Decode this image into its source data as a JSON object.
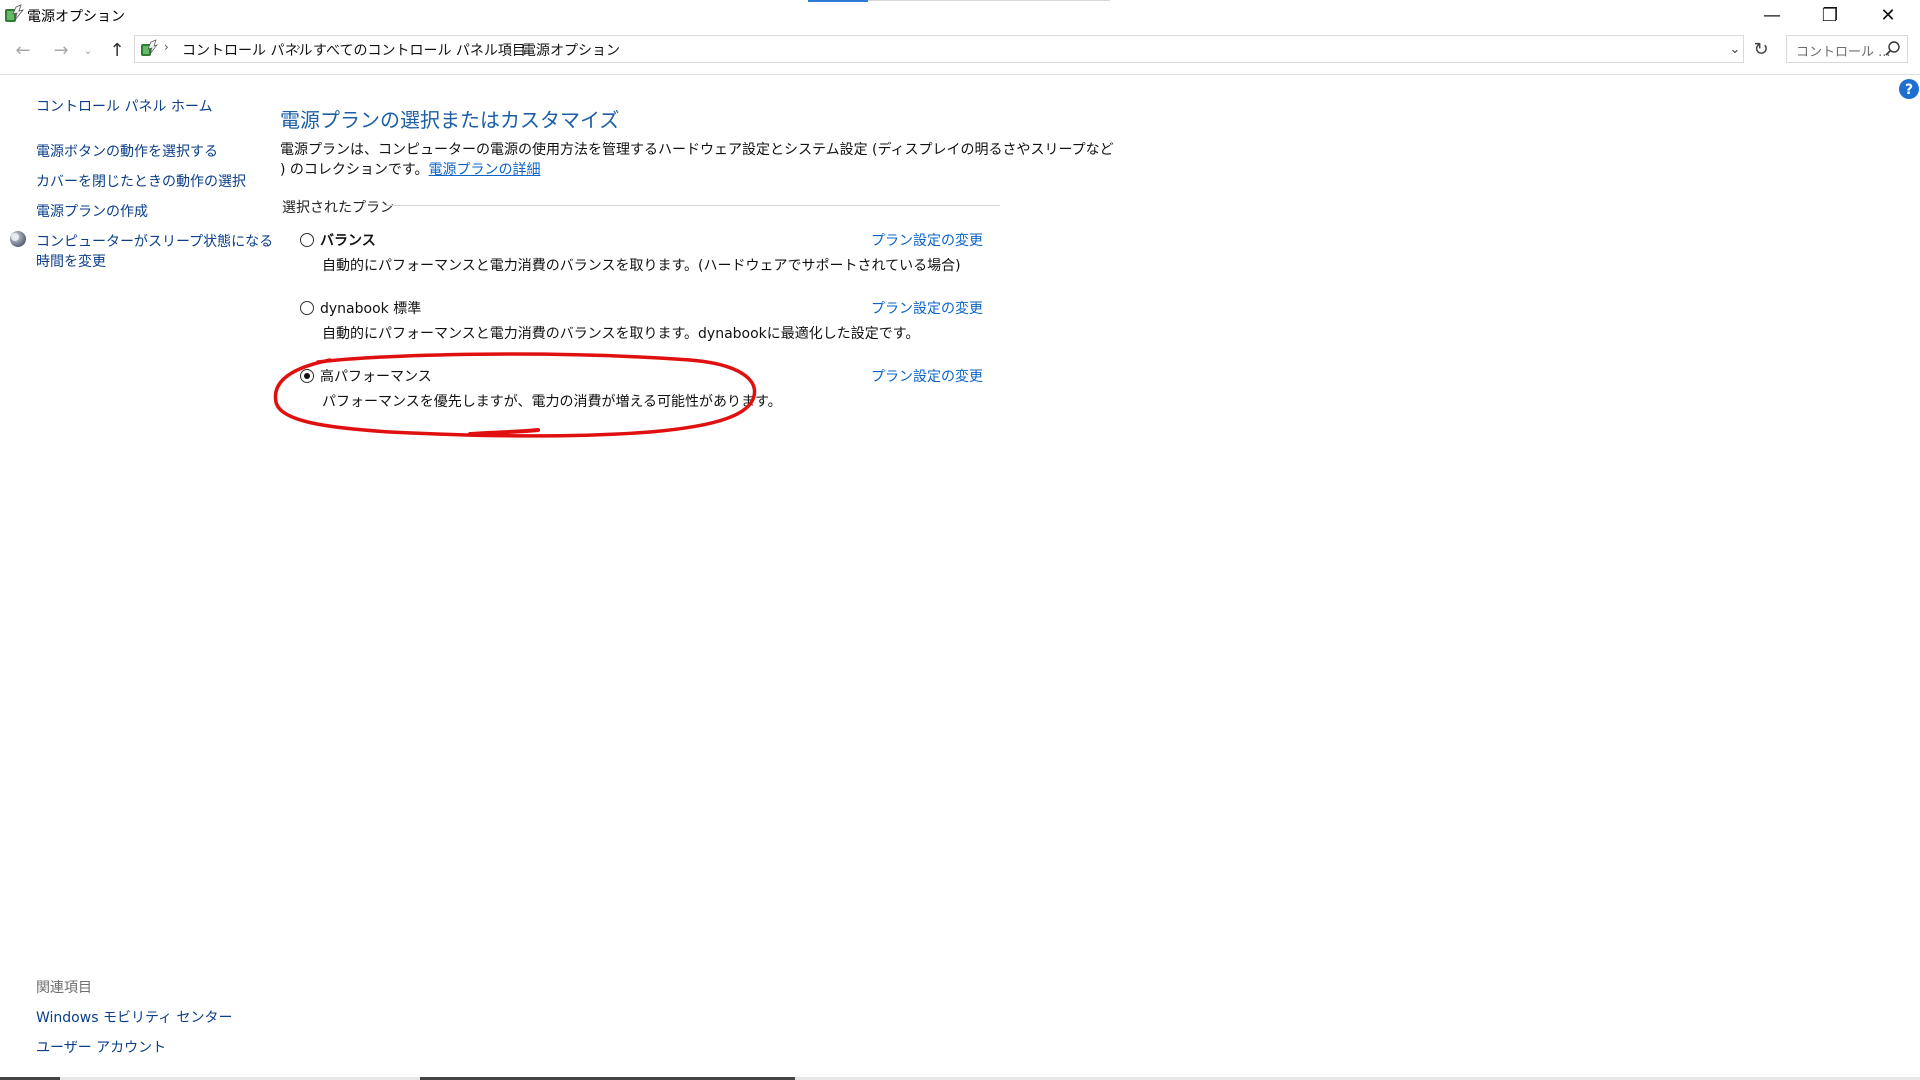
{
  "window": {
    "title": "電源オプション",
    "controls": {
      "minimize": "—",
      "maximize": "❐",
      "close": "✕"
    }
  },
  "nav": {
    "back": "←",
    "forward": "→",
    "recent": "⌄",
    "up": "↑",
    "breadcrumbs": [
      "コントロール パネル",
      "すべてのコントロール パネル項目",
      "電源オプション"
    ],
    "separator": "›",
    "dropdown": "⌄",
    "refresh": "↻",
    "search_placeholder": "コントロール ..."
  },
  "left_pane": {
    "home": "コントロール パネル ホーム",
    "tasks": [
      "電源ボタンの動作を選択する",
      "カバーを閉じたときの動作の選択",
      "電源プランの作成"
    ],
    "sleep_line1": "コンピューターがスリープ状態になる",
    "sleep_line2": "時間を変更",
    "related_label": "関連項目",
    "related": [
      "Windows モビリティ センター",
      "ユーザー アカウント"
    ]
  },
  "main": {
    "title": "電源プランの選択またはカスタマイズ",
    "desc_line1": "電源プランは、コンピューターの電源の使用方法を管理するハードウェア設定とシステム設定 (ディスプレイの明るさやスリープなど",
    "desc_line2": ") のコレクションです。",
    "desc_link": "電源プランの詳細",
    "section_label": "選択されたプラン",
    "plans": [
      {
        "name": "バランス",
        "description": "自動的にパフォーマンスと電力消費のバランスを取ります。(ハードウェアでサポートされている場合)",
        "link": "プラン設定の変更",
        "selected": false
      },
      {
        "name": "dynabook 標準",
        "description": "自動的にパフォーマンスと電力消費のバランスを取ります。dynabookに最適化した設定です。",
        "link": "プラン設定の変更",
        "selected": false
      },
      {
        "name": "高パフォーマンス",
        "description": "パフォーマンスを優先しますが、電力の消費が増える可能性があります。",
        "link": "プラン設定の変更",
        "selected": true
      }
    ]
  },
  "help": "?",
  "colors": {
    "link": "#0a64c8",
    "title": "#1c5fa8",
    "annotation": "#e01010",
    "help": "#1e6fd0"
  }
}
